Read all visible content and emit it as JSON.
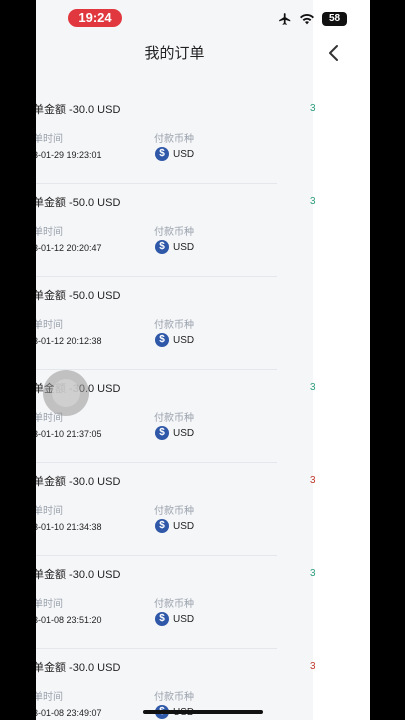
{
  "status": {
    "time": "19:24",
    "battery": "58"
  },
  "header": {
    "title": "我的订单"
  },
  "orders": [
    {
      "amount": "单金额 -30.0 USD",
      "time_label": "单时间",
      "time": "3-01-29 19:23:01",
      "currency_label": "付款币种",
      "currency": "USD",
      "side": "3"
    },
    {
      "amount": "单金额 -50.0 USD",
      "time_label": "单时间",
      "time": "3-01-12 20:20:47",
      "currency_label": "付款币种",
      "currency": "USD",
      "side": "3"
    },
    {
      "amount": "单金额 -50.0 USD",
      "time_label": "单时间",
      "time": "3-01-12 20:12:38",
      "currency_label": "付款币种",
      "currency": "USD",
      "side": ""
    },
    {
      "amount": "单金额 -30.0 USD",
      "time_label": "单时间",
      "time": "3-01-10 21:37:05",
      "currency_label": "付款币种",
      "currency": "USD",
      "side": "3"
    },
    {
      "amount": "单金额 -30.0 USD",
      "time_label": "单时间",
      "time": "3-01-10 21:34:38",
      "currency_label": "付款币种",
      "currency": "USD",
      "side": "3"
    },
    {
      "amount": "单金额 -30.0 USD",
      "time_label": "单时间",
      "time": "3-01-08 23:51:20",
      "currency_label": "付款币种",
      "currency": "USD",
      "side": "3"
    },
    {
      "amount": "单金额 -30.0 USD",
      "time_label": "单时间",
      "time": "3-01-08 23:49:07",
      "currency_label": "付款币种",
      "currency": "USD",
      "side": "3"
    }
  ],
  "colors": {
    "accent_green": "#2a9d7a",
    "accent_red": "#c0392b",
    "coin": "#2f58a8",
    "status_pill": "#e0383e"
  }
}
